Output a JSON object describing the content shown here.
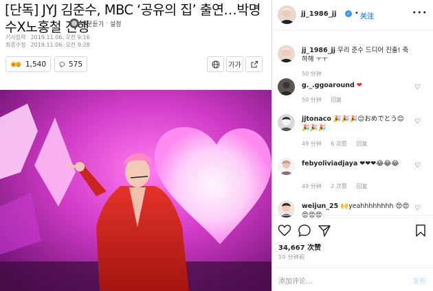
{
  "article": {
    "headline": "[단독] JYJ 김준수, MBC ‘공유의 집’ 출연…박명수X노홍철 진행",
    "listen_label": "본문듣기",
    "settings_label": "설정",
    "separator": "·",
    "input_label": "기사입력",
    "input_time": "2019.11.06. 오전 9:16",
    "modified_label": "최종수정",
    "modified_time": "2019.11.06. 오전 9:28",
    "reaction_count": "1,540",
    "comment_count": "575",
    "font_size_label": "가가"
  },
  "post": {
    "username": "jj_1986_jj",
    "verified_mark": "✓",
    "dot": "•",
    "follow_label": "关注",
    "more_label": "•••",
    "caption_user": "jj_1986_jj",
    "caption_text": "우리 준수 드디어 진출! 축하해 ㅜㅜ",
    "caption_time": "50 分钟",
    "likes_text": "34,667 次赞",
    "time_ago": "50 分钟前",
    "add_comment_placeholder": "添加评论...",
    "post_button": "发布"
  },
  "comments": [
    {
      "user": "g._.ggoaround",
      "text": "❤",
      "time": "50 分钟",
      "likes": "",
      "reply": "回复"
    },
    {
      "user": "jjtonaco",
      "text": "🎉🎉🎉😊おめでとう😊🎉🎉🎉",
      "time": "49 分钟",
      "likes": "6 次赞",
      "reply": "回复"
    },
    {
      "user": "febyoliviadjaya",
      "text": "❤❤❤😂😂😂",
      "time": "49 分钟",
      "likes": "2 次赞",
      "reply": "回复"
    },
    {
      "user": "weijun_25",
      "text": "🙌yeahhhhhhhh 😍😍😍😍😍",
      "time": "",
      "likes": "",
      "reply": ""
    }
  ],
  "comment_meta": {
    "c0_time": "50 分钟",
    "c0_reply": "回复",
    "c1_time": "49 分钟",
    "c1_likes": "6 次赞",
    "c1_reply": "回复",
    "c2_time": "49 分钟",
    "c2_likes": "2 次赞",
    "c2_reply": "回复"
  },
  "colors": {
    "accent": "#3897f0",
    "stage_pink": "#e83bd6",
    "outfit_red": "#d4231f"
  }
}
